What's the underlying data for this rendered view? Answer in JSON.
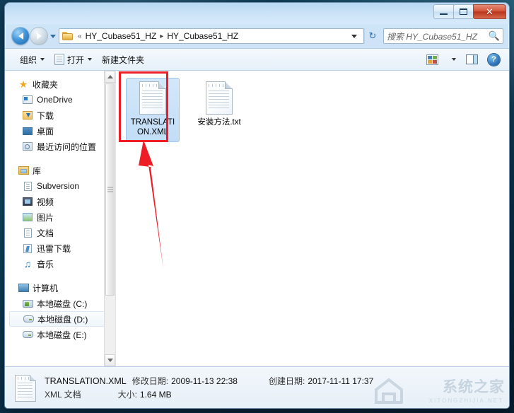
{
  "window": {
    "controls": {
      "minimize": "minimize-button",
      "maximize": "maximize-button",
      "close_label": "✕"
    }
  },
  "nav": {
    "back_tooltip": "后退",
    "forward_tooltip": "前进",
    "breadcrumb": {
      "prefix": "«",
      "separator": "▸",
      "parts": [
        "HY_Cubase51_HZ",
        "HY_Cubase51_HZ"
      ]
    },
    "refresh_glyph": "↻",
    "search": {
      "placeholder": "搜索 HY_Cubase51_HZ",
      "icon": "search-icon"
    }
  },
  "toolbar": {
    "organize_label": "组织",
    "open_label": "打开",
    "new_folder_label": "新建文件夹",
    "view_icon": "view-options-icon",
    "preview_pane_icon": "preview-pane-icon",
    "help_label": "?"
  },
  "sidebar": {
    "groups": [
      {
        "header": {
          "label": "收藏夹",
          "icon": "star-icon"
        },
        "items": [
          {
            "label": "OneDrive",
            "icon": "onedrive-icon"
          },
          {
            "label": "下载",
            "icon": "downloads-icon"
          },
          {
            "label": "桌面",
            "icon": "desktop-icon"
          },
          {
            "label": "最近访问的位置",
            "icon": "recent-places-icon"
          }
        ]
      },
      {
        "header": {
          "label": "库",
          "icon": "library-icon"
        },
        "items": [
          {
            "label": "Subversion",
            "icon": "document-icon"
          },
          {
            "label": "视频",
            "icon": "video-icon"
          },
          {
            "label": "图片",
            "icon": "pictures-icon"
          },
          {
            "label": "文档",
            "icon": "document-icon"
          },
          {
            "label": "迅雷下载",
            "icon": "thunder-download-icon"
          },
          {
            "label": "音乐",
            "icon": "music-icon"
          }
        ]
      },
      {
        "header": {
          "label": "计算机",
          "icon": "computer-icon"
        },
        "items": [
          {
            "label": "本地磁盘 (C:)",
            "icon": "system-disk-icon",
            "selected": false
          },
          {
            "label": "本地磁盘 (D:)",
            "icon": "disk-icon",
            "selected": true
          },
          {
            "label": "本地磁盘 (E:)",
            "icon": "disk-icon",
            "selected": false
          }
        ]
      }
    ]
  },
  "files": [
    {
      "name": "TRANSLATION.XML",
      "icon": "xml-document-icon",
      "selected": true
    },
    {
      "name": "安装方法.txt",
      "icon": "text-document-icon",
      "selected": false
    }
  ],
  "annotations": {
    "highlight_color": "#ee1c25",
    "box_target": "TRANSLATION.XML",
    "arrow": "points-to-translation-xml"
  },
  "status": {
    "file_name": "TRANSLATION.XML",
    "modified_label": "修改日期:",
    "modified_value": "2009-11-13 22:38",
    "created_label": "创建日期:",
    "created_value": "2017-11-11 17:37",
    "type_value": "XML 文档",
    "size_label": "大小:",
    "size_value": "1.64 MB"
  },
  "watermark": {
    "title": "系统之家",
    "subtitle": "XITONGZHIJIA.NET"
  }
}
